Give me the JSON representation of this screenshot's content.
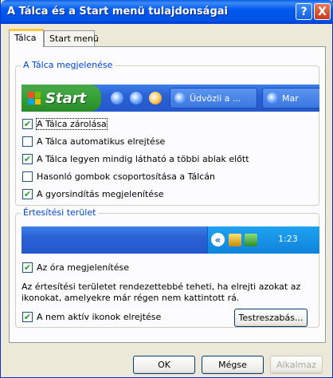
{
  "window": {
    "title": "A Tálca és a Start menü tulajdonságai",
    "help_label": "?",
    "close_label": "X"
  },
  "tabs": [
    {
      "label": "Tálca",
      "active": true
    },
    {
      "label": "Start menü",
      "active": false
    }
  ],
  "appearance_group": {
    "legend": "A Tálca megjelenése",
    "preview": {
      "start_label": "Start",
      "task_buttons": [
        "Üdvözli a ...",
        "Mar"
      ]
    },
    "options": [
      {
        "label": "A Tálca zárolása",
        "checked": true
      },
      {
        "label": "A Tálca automatikus elrejtése",
        "checked": false
      },
      {
        "label": "A Tálca legyen mindig látható a többi ablak előtt",
        "checked": true
      },
      {
        "label": "Hasonló gombok csoportosítása a Tálcán",
        "checked": false
      },
      {
        "label": "A gyorsindítás megjelenítése",
        "checked": true
      }
    ]
  },
  "notification_group": {
    "legend": "Értesítési terület",
    "clock_text": "1:23",
    "show_clock": {
      "label": "Az óra megjelenítése",
      "checked": true
    },
    "description": "Az értesítési területet rendezettebbé teheti, ha elrejti azokat az ikonokat, amelyekre már régen nem kattintott rá.",
    "hide_inactive": {
      "label": "A nem aktív ikonok elrejtése",
      "checked": true
    },
    "customize_label": "Testreszabás..."
  },
  "footer": {
    "ok_label": "OK",
    "cancel_label": "Mégse",
    "apply_label": "Alkalmaz"
  },
  "colors": {
    "titlebar": "#0058ee",
    "dialog_bg": "#ece9d8",
    "group_legend": "#0046d5",
    "checkmark": "#21a121"
  }
}
